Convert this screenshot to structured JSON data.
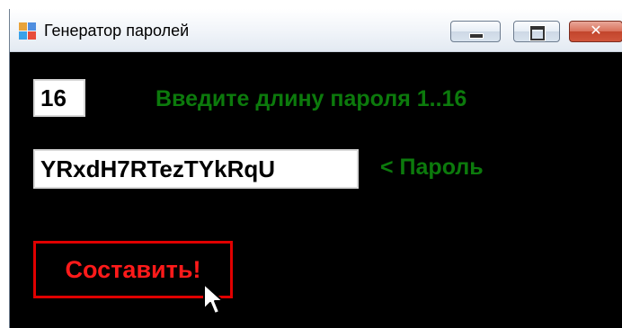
{
  "window": {
    "title": "Генератор паролей",
    "close_glyph": "✕"
  },
  "form": {
    "length_value": "16",
    "length_hint": "Введите длину пароля 1..16",
    "password_value": "YRxdH7RTezTYkRqU",
    "password_hint": "< Пароль",
    "generate_label": "Составить!"
  },
  "colors": {
    "form_background": "#000000",
    "hint_text": "#0c7a0c",
    "button_text": "#ff1a1a",
    "button_border": "#e00000"
  },
  "icons": [
    "app-icon",
    "minimize-icon",
    "maximize-icon",
    "close-icon",
    "mouse-cursor-icon"
  ]
}
